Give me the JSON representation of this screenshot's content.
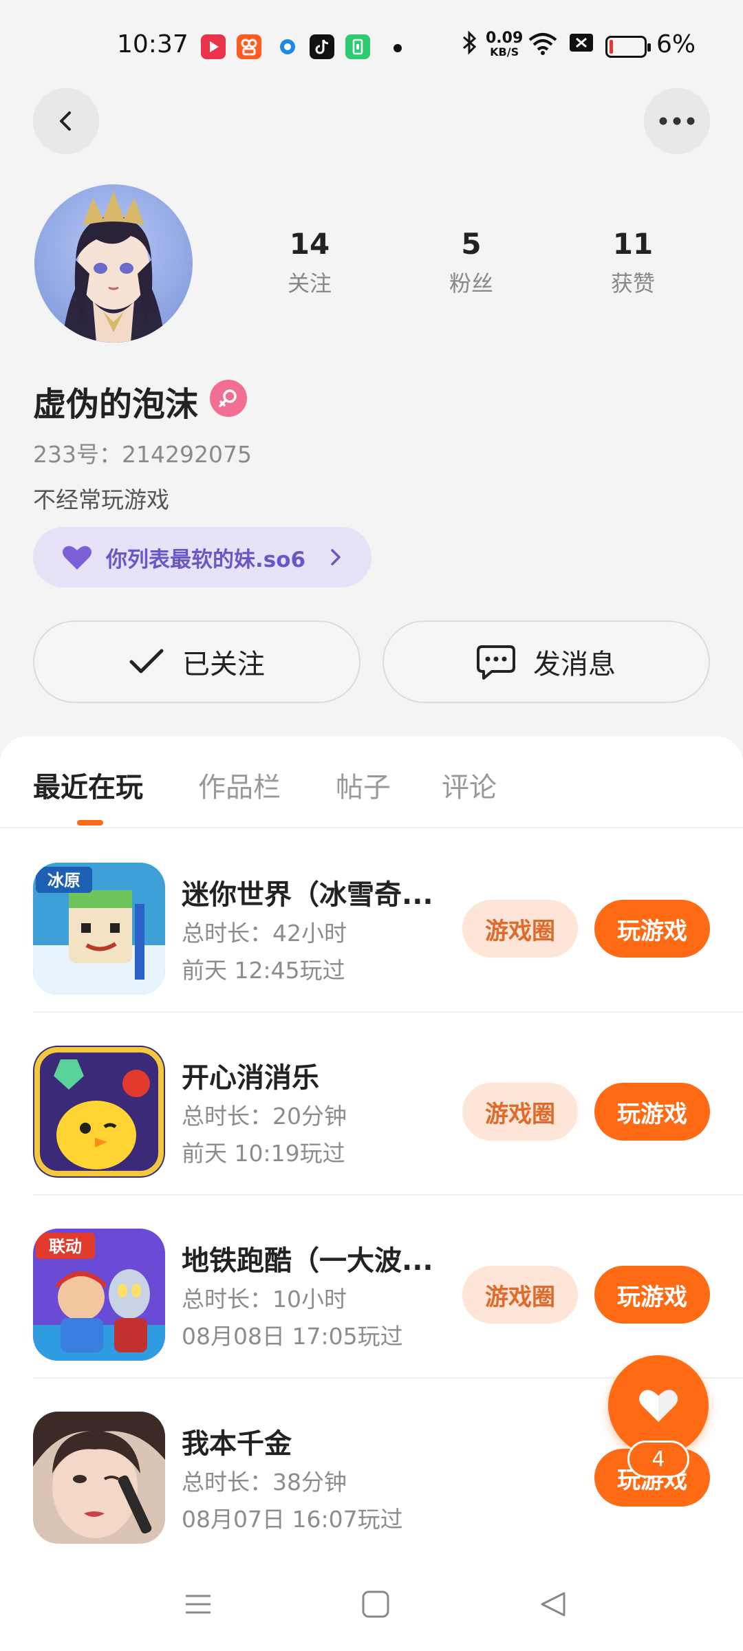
{
  "status_bar": {
    "time": "10:37",
    "net_speed_value": "0.09",
    "net_speed_unit": "KB/S",
    "battery_pct": "6%",
    "battery_level": 0.06
  },
  "profile": {
    "following_count": "14",
    "following_label": "关注",
    "fans_count": "5",
    "fans_label": "粉丝",
    "likes_count": "11",
    "likes_label": "获赞",
    "nickname": "虚伪的泡沫",
    "uid": "233号：214292075",
    "bio": "不经常玩游戏",
    "tag_text": "你列表最软的妹.so6"
  },
  "actions": {
    "follow_label": "已关注",
    "message_label": "发消息"
  },
  "tabs": [
    {
      "label": "最近在玩"
    },
    {
      "label": "作品栏"
    },
    {
      "label": "帖子"
    },
    {
      "label": "评论"
    }
  ],
  "games": [
    {
      "title": "迷你世界（冰雪奇...",
      "duration": "总时长：42小时",
      "last_played": "前天 12:45玩过",
      "icon_badge": "冰原",
      "circle_label": "游戏圈",
      "play_label": "玩游戏"
    },
    {
      "title": "开心消消乐",
      "duration": "总时长：20分钟",
      "last_played": "前天 10:19玩过",
      "circle_label": "游戏圈",
      "play_label": "玩游戏"
    },
    {
      "title": "地铁跑酷（一大波...",
      "duration": "总时长：10小时",
      "last_played": "08月08日 17:05玩过",
      "icon_badge": "联动",
      "circle_label": "游戏圈",
      "play_label": "玩游戏"
    },
    {
      "title": "我本千金",
      "duration": "总时长：38分钟",
      "last_played": "08月07日 16:07玩过",
      "play_label": "玩游戏"
    }
  ],
  "fab": {
    "badge": "4"
  },
  "colors": {
    "accent": "#ff6a14",
    "accent_light": "#fde5d8",
    "tag_bg": "#e7e2f8",
    "tag_text": "#6a56c6",
    "gender_pink": "#f36e93"
  }
}
